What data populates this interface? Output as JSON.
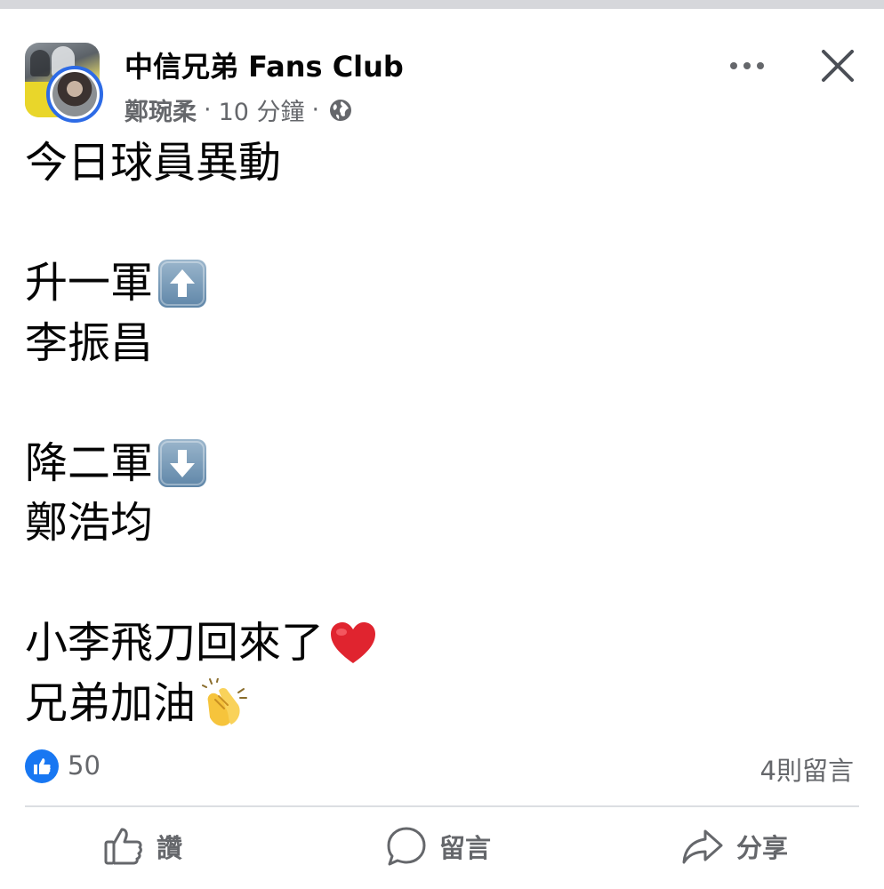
{
  "header": {
    "group_name": "中信兄弟 Fans Club",
    "author": "鄭琬柔",
    "separator": "·",
    "time": "10 分鐘",
    "separator2": "·"
  },
  "post": {
    "lines": [
      "今日球員異動",
      "",
      "升一軍",
      "李振昌",
      "",
      "降二軍",
      "鄭浩均",
      "",
      "小李飛刀回來了",
      "兄弟加油"
    ]
  },
  "reactions": {
    "like_count": "50",
    "comment_count": "4則留言"
  },
  "actions": {
    "like_label": "讚",
    "comment_label": "留言",
    "share_label": "分享"
  },
  "icons": {
    "like": "thumbs-up-icon",
    "comment": "speech-bubble-icon",
    "share": "share-arrow-icon",
    "privacy": "globe-icon",
    "more": "more-dots-icon",
    "close": "close-icon"
  },
  "colors": {
    "accent": "#1877f2",
    "meta_text": "#65676b",
    "avatar_ring": "#2d6be6",
    "heart": "#e0242f"
  }
}
